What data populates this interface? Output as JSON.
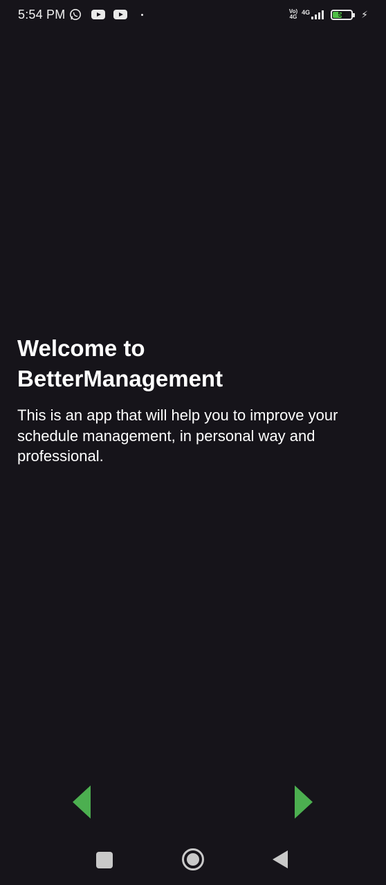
{
  "status_bar": {
    "time": "5:54 PM",
    "icons": [
      "whatsapp-icon",
      "youtube-icon",
      "youtube-icon",
      "dot-icon"
    ],
    "network_top": "Vo)",
    "network_bottom": "4G",
    "network2_top": "4G",
    "battery_level": "50",
    "charging_icon": "bolt-icon"
  },
  "welcome": {
    "title": "Welcome to\nBetterManagement",
    "body": "This is an app that will help you to improve your schedule management, in personal way and professional."
  },
  "navigation": {
    "prev_icon": "triangle-left-icon",
    "next_icon": "triangle-right-icon",
    "arrow_color": "#4caf50"
  },
  "system_nav": {
    "recent_icon": "square-icon",
    "home_icon": "circle-icon",
    "back_icon": "triangle-back-icon"
  }
}
